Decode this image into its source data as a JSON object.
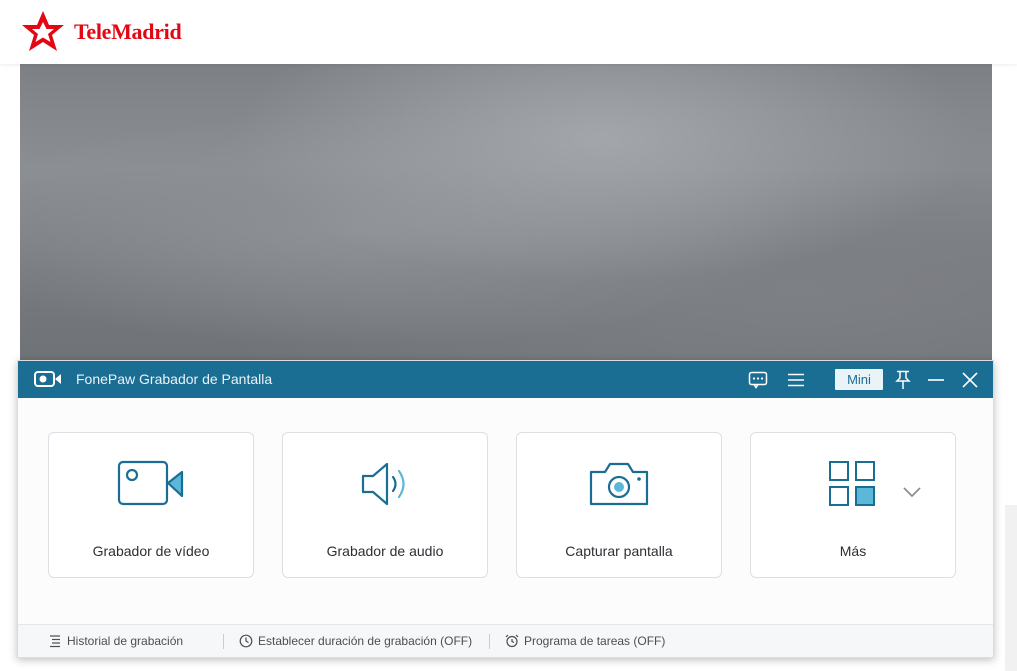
{
  "site": {
    "brand": "TeleMadrid",
    "brand_color": "#e30613"
  },
  "recorder": {
    "title": "FonePaw Grabador de Pantalla",
    "titlebar_color": "#1a6d93",
    "titlebar_buttons": {
      "feedback_icon": "chat-icon",
      "menu_icon": "hamburger-icon",
      "mini_label": "Mini",
      "pin_icon": "pin-icon",
      "minimize_icon": "minimize-icon",
      "close_icon": "close-icon"
    },
    "cards": [
      {
        "label": "Grabador de vídeo",
        "icon": "video-camera-icon"
      },
      {
        "label": "Grabador de audio",
        "icon": "speaker-icon"
      },
      {
        "label": "Capturar pantalla",
        "icon": "camera-icon"
      },
      {
        "label": "Más",
        "icon": "grid-icon"
      }
    ],
    "footer": {
      "history": "Historial de grabación",
      "duration": "Establecer duración de grabación (OFF)",
      "schedule": "Programa de tareas (OFF)"
    }
  }
}
